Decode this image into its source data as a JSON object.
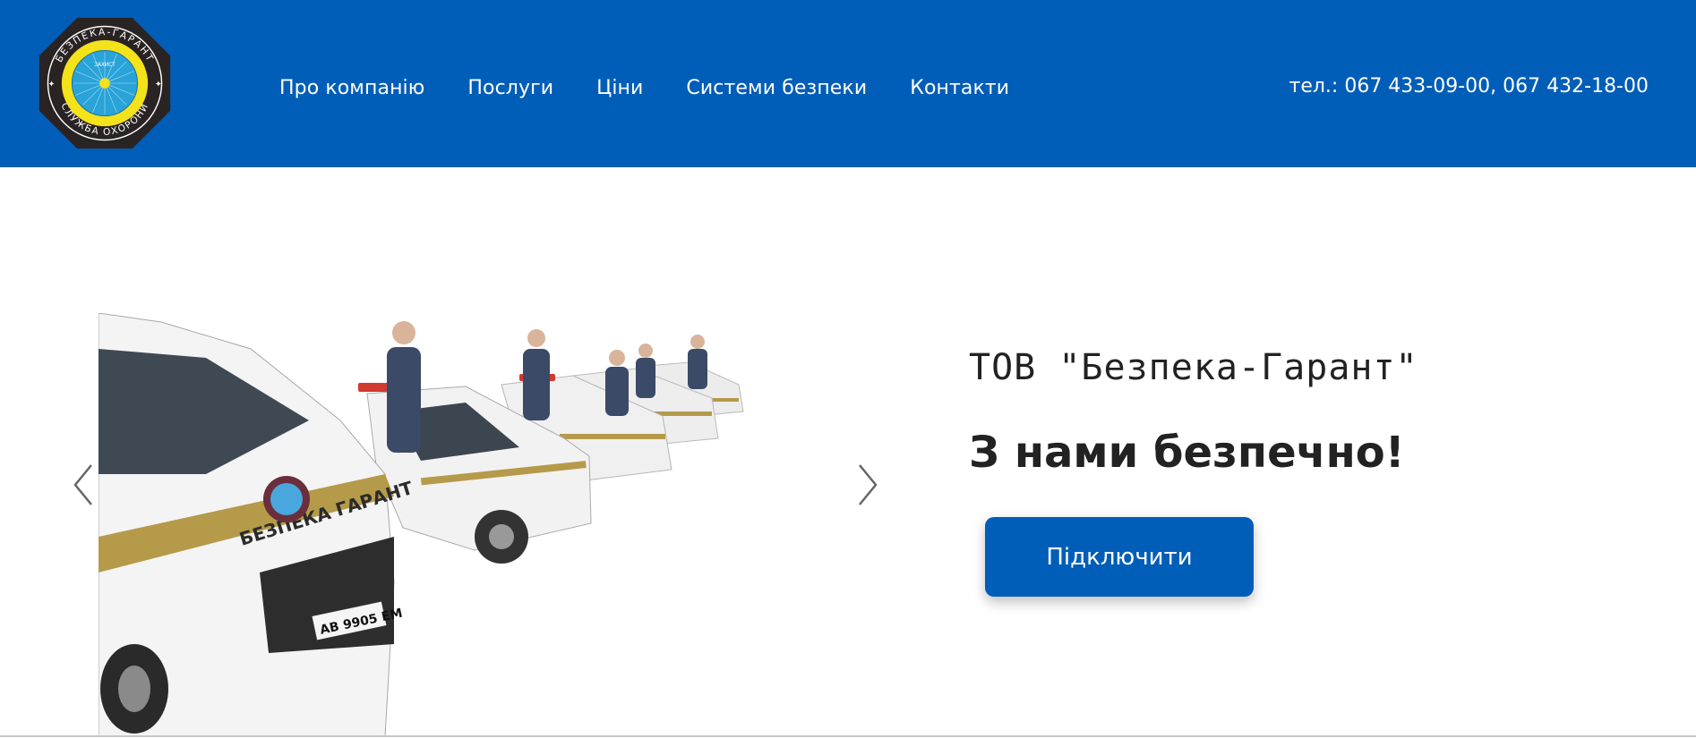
{
  "header": {
    "logo": {
      "top_arc_text": "БЕЗПЕКА-ГАРАНТ",
      "bottom_arc_text": "СЛУЖБА ОХОРОНИ",
      "inner_text": "ЗАХИСТ",
      "colors": {
        "ring": "#2a2323",
        "center": "#f4e21a",
        "inner": "#2aa3d8"
      }
    },
    "nav": [
      {
        "label": "Про компанію"
      },
      {
        "label": "Послуги"
      },
      {
        "label": "Ціни"
      },
      {
        "label": "Системи безпеки"
      },
      {
        "label": "Контакти"
      }
    ],
    "phone": "тел.: 067 433-09-00, 067 432-18-00"
  },
  "hero": {
    "slider": {
      "prev_icon": "chevron-left-icon",
      "next_icon": "chevron-right-icon",
      "car_side_text": "БЕЗПЕКА ГАРАНТ",
      "plate_text": "АВ 9905 ЕМ"
    },
    "company_name": "ТОВ \"Безпека-Гарант\"",
    "tagline": "З нами безпечно!",
    "cta_label": "Підключити"
  },
  "colors": {
    "brand": "#005eb8",
    "text": "#222222"
  }
}
